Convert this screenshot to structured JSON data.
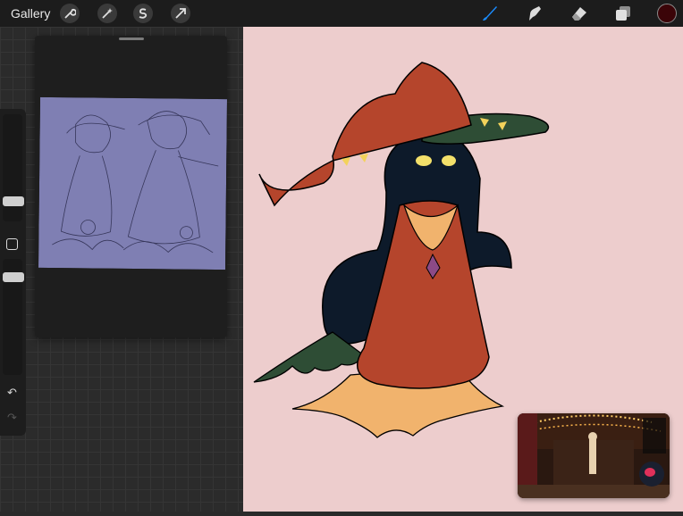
{
  "topbar": {
    "gallery_label": "Gallery",
    "left_tools": [
      "wrench-icon",
      "magic-wand-icon",
      "selection-icon",
      "transform-arrow-icon"
    ],
    "right_tools": [
      "brush-icon",
      "smudge-icon",
      "eraser-icon",
      "layers-icon"
    ],
    "active_tool": "brush-icon",
    "current_color": "#3b0408"
  },
  "sidebar": {
    "brush_size": 0.22,
    "brush_opacity": 0.9,
    "undo_icon": "↶",
    "redo_icon": "↷"
  },
  "colors": {
    "canvas_bg": "#edcdcd",
    "hat": "#b5452c",
    "body": "#0d1a2a",
    "leaf": "#2e4d35",
    "robe_bottom": "#f1b36d",
    "accent_blue": "#1a8cff"
  }
}
